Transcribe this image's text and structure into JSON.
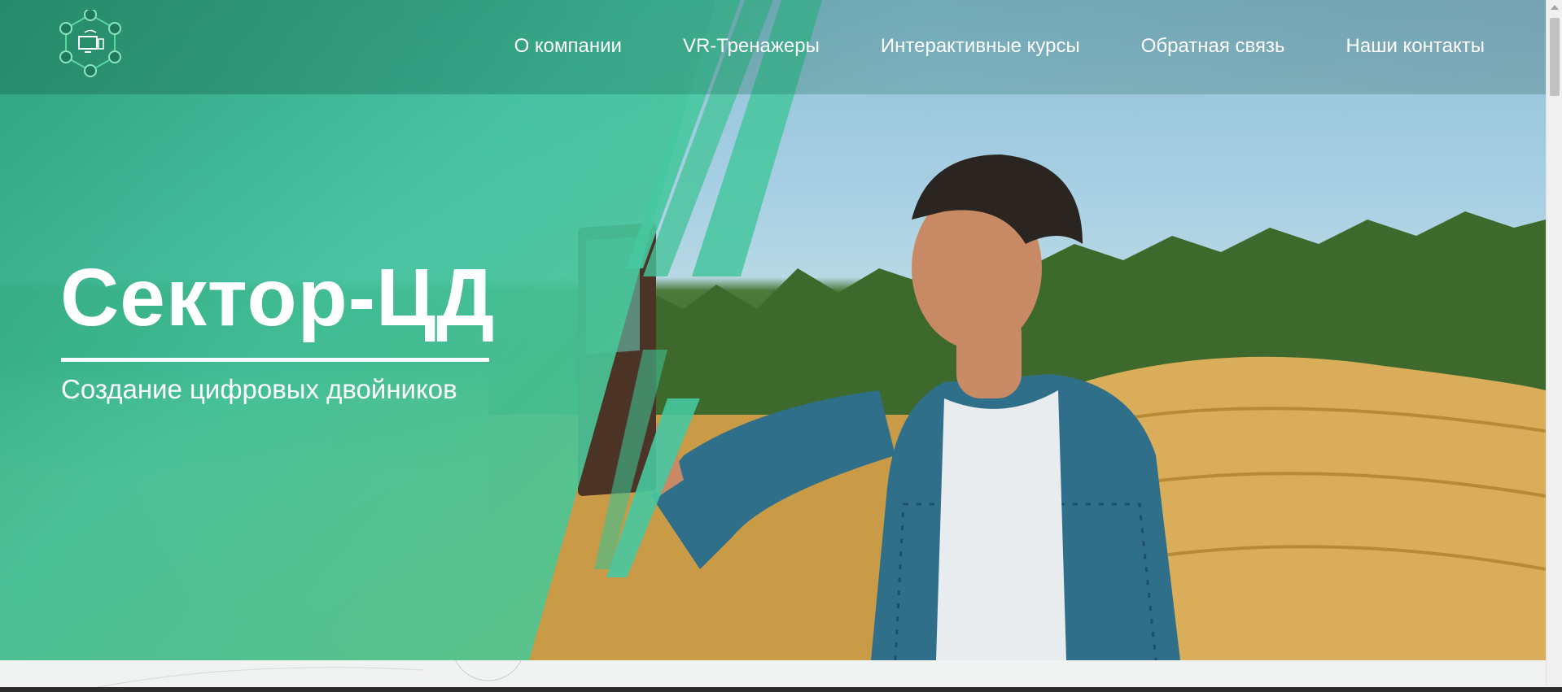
{
  "nav": {
    "items": [
      {
        "label": "О компании"
      },
      {
        "label": "VR-Тренажеры"
      },
      {
        "label": "Интерактивные курсы"
      },
      {
        "label": "Обратная связь"
      },
      {
        "label": "Наши контакты"
      }
    ]
  },
  "hero": {
    "title": "Сектор-ЦД",
    "subtitle": "Создание цифровых двойников"
  },
  "colors": {
    "accent_green": "#3fbf8f",
    "overlay_green": "#2fb889",
    "text_light": "#ffffff"
  },
  "icons": {
    "logo": "digital-twin-network-logo"
  }
}
